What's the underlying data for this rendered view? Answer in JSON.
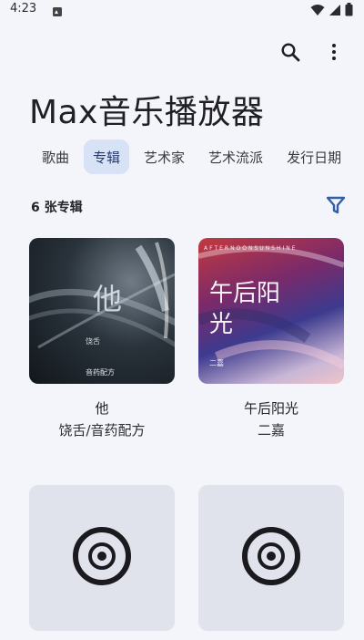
{
  "status": {
    "time": "4:23",
    "notif_icon": "notification-icon",
    "wifi_icon": "wifi-icon",
    "signal_icon": "signal-icon",
    "battery_icon": "battery-icon"
  },
  "top_actions": {
    "search_icon": "search-icon",
    "more_icon": "more-vert-icon"
  },
  "app_title": "Max音乐播放器",
  "tabs": [
    {
      "label": "歌曲",
      "active": false
    },
    {
      "label": "专辑",
      "active": true
    },
    {
      "label": "艺术家",
      "active": false
    },
    {
      "label": "艺术流派",
      "active": false
    },
    {
      "label": "发行日期",
      "active": false
    }
  ],
  "album_count": "6 张专辑",
  "filter_icon": "filter-icon",
  "albums": [
    {
      "title": "他",
      "artist": "饶舌/音药配方",
      "cover_text": "他",
      "cover_caption": "饶舌",
      "cover_label": "音药配方"
    },
    {
      "title": "午后阳光",
      "artist": "二嘉",
      "cover_text": "午后阳光",
      "cover_caption": "二嘉",
      "cover_label": "AFTERNOONSUNSHINE"
    },
    {
      "title": "",
      "artist": "",
      "placeholder_icon": "disc-icon"
    },
    {
      "title": "",
      "artist": "",
      "placeholder_icon": "disc-icon"
    }
  ],
  "colors": {
    "background": "#f4f5fb",
    "tab_active_bg": "#d7e2f7",
    "filter_icon": "#2f5fa8",
    "placeholder_bg": "#e1e3ec"
  }
}
